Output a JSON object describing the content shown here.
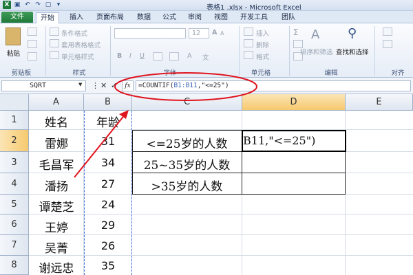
{
  "window": {
    "title": "表格1 .xlsx - Microsoft Excel"
  },
  "tabs": [
    "文件",
    "开始",
    "插入",
    "页面布局",
    "数据",
    "公式",
    "审阅",
    "视图",
    "开发工具",
    "团队"
  ],
  "ribbon": {
    "paste": "粘贴",
    "clipboard_group": "剪贴板",
    "styles_group": "样式",
    "conditional_format": "条件格式",
    "table_format": "套用表格格式",
    "cell_styles": "单元格样式",
    "font_group": "字体",
    "font_size": "12",
    "cells_group": "单元格",
    "insert": "插入",
    "delete": "删除",
    "format": "格式",
    "editing_group": "编辑",
    "sort_filter": "排序和筛选",
    "find_select": "查找和选择",
    "align_group": "对齐"
  },
  "formula_bar": {
    "name_box": "SQRT",
    "formula_prefix": "=COUNTIF(",
    "formula_ref": "B1:B11",
    "formula_suffix": ",\"<=25\")"
  },
  "columns": [
    "A",
    "B",
    "C",
    "D",
    "E"
  ],
  "rows": [
    "1",
    "2",
    "3",
    "4",
    "5",
    "6",
    "7",
    "8"
  ],
  "cells": {
    "a": [
      "姓名",
      "雷娜",
      "毛昌军",
      "潘扬",
      "谭楚芝",
      "王婷",
      "吴菁",
      "谢远忠"
    ],
    "b": [
      "年龄",
      "31",
      "34",
      "27",
      "24",
      "29",
      "26",
      "35"
    ],
    "c": [
      "<=25岁的人数",
      "25~35岁的人数",
      ">35岁的人数"
    ],
    "d2_editing": "B11,\"<=25\")"
  },
  "colors": {
    "annotation": "#e0141e",
    "range_highlight": "#3d6fe0",
    "file_tab": "#1f7a3a"
  }
}
